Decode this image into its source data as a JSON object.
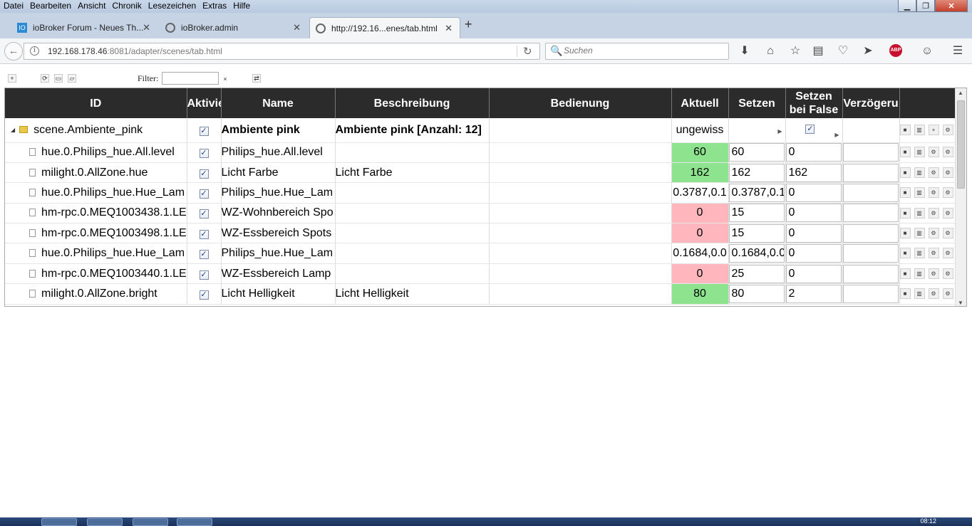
{
  "menu": [
    "Datei",
    "Bearbeiten",
    "Ansicht",
    "Chronik",
    "Lesezeichen",
    "Extras",
    "Hilfe"
  ],
  "window_controls": {
    "minimize": "▁",
    "maximize": "❐",
    "close": "✕"
  },
  "tabs": [
    {
      "label": "ioBroker Forum - Neues Th...",
      "icon": "iobroker-icon",
      "close": "✕"
    },
    {
      "label": "ioBroker.admin",
      "icon": "gear-icon",
      "close": "✕"
    },
    {
      "label": "http://192.16...enes/tab.html",
      "icon": "gear-icon",
      "close": "✕"
    }
  ],
  "new_tab": "+",
  "nav": {
    "back": "←",
    "info": "i",
    "url_host": "192.168.178.46",
    "url_path": ":8081/adapter/scenes/tab.html",
    "reload": "↻",
    "search_placeholder": "Suchen",
    "search_icon": "🔍"
  },
  "toolbar_icons": [
    "download-icon",
    "home-icon",
    "bookmark-star-icon",
    "reading-list-icon",
    "pocket-icon",
    "send-icon",
    "adblock-icon",
    "emoji-icon",
    "menu-icon"
  ],
  "toolbar_glyphs": [
    "⬇",
    "⌂",
    "☆",
    "▤",
    "♡",
    "➤",
    "ABP",
    "☺",
    "☰"
  ],
  "scenes_toolbar": {
    "add": "+",
    "refresh": "⟳",
    "folder": "▭",
    "open": "▱",
    "filter_label": "Filter:",
    "clear": "×",
    "swap": "⇄"
  },
  "table": {
    "headers": [
      "ID",
      "Aktiviert",
      "Name",
      "Beschreibung",
      "Bedienung",
      "Aktuell",
      "Setzen",
      "Setzen bei False",
      "Verzögerung"
    ],
    "header_setzen_false_line1": "Setzen",
    "header_setzen_false_line2": "bei False",
    "header_verz": "Verzögeru",
    "header_akt": "Aktivie",
    "root": {
      "id": "scene.Ambiente_pink",
      "name": "Ambiente pink",
      "desc": "Ambiente pink [Anzahl: 12]",
      "aktuell": "ungewiss"
    },
    "rows": [
      {
        "id": "hue.0.Philips_hue.All.level",
        "name": "Philips_hue.All.level",
        "desc": "",
        "aktuell": "60",
        "state": "green",
        "setzen": "60",
        "false": "0"
      },
      {
        "id": "milight.0.AllZone.hue",
        "name": "Licht Farbe",
        "desc": "Licht Farbe",
        "aktuell": "162",
        "state": "green",
        "setzen": "162",
        "false": "162"
      },
      {
        "id": "hue.0.Philips_hue.Hue_Lam",
        "name": "Philips_hue.Hue_Lam",
        "desc": "",
        "aktuell": "0.3787,0.1",
        "state": "plain",
        "setzen": "0.3787,0.1",
        "false": "0"
      },
      {
        "id": "hm-rpc.0.MEQ1003438.1.LE",
        "name": "WZ-Wohnbereich Spo",
        "desc": "",
        "aktuell": "0",
        "state": "red",
        "setzen": "15",
        "false": "0"
      },
      {
        "id": "hm-rpc.0.MEQ1003498.1.LE",
        "name": "WZ-Essbereich Spots",
        "desc": "",
        "aktuell": "0",
        "state": "red",
        "setzen": "15",
        "false": "0"
      },
      {
        "id": "hue.0.Philips_hue.Hue_Lam",
        "name": "Philips_hue.Hue_Lam",
        "desc": "",
        "aktuell": "0.1684,0.0",
        "state": "plain",
        "setzen": "0.1684,0.0",
        "false": "0"
      },
      {
        "id": "hm-rpc.0.MEQ1003440.1.LE",
        "name": "WZ-Essbereich Lamp",
        "desc": "",
        "aktuell": "0",
        "state": "red",
        "setzen": "25",
        "false": "0"
      },
      {
        "id": "milight.0.AllZone.bright",
        "name": "Licht Helligkeit",
        "desc": "Licht Helligkeit",
        "aktuell": "80",
        "state": "green",
        "setzen": "80",
        "false": "2"
      }
    ]
  },
  "check_glyph": "✓",
  "play_glyph": "▶",
  "tree_expand": "◢",
  "colors": {
    "green": "#8ee48e",
    "red": "#ffb6bd",
    "header": "#2b2b2b"
  },
  "taskbar_time": "08:12"
}
